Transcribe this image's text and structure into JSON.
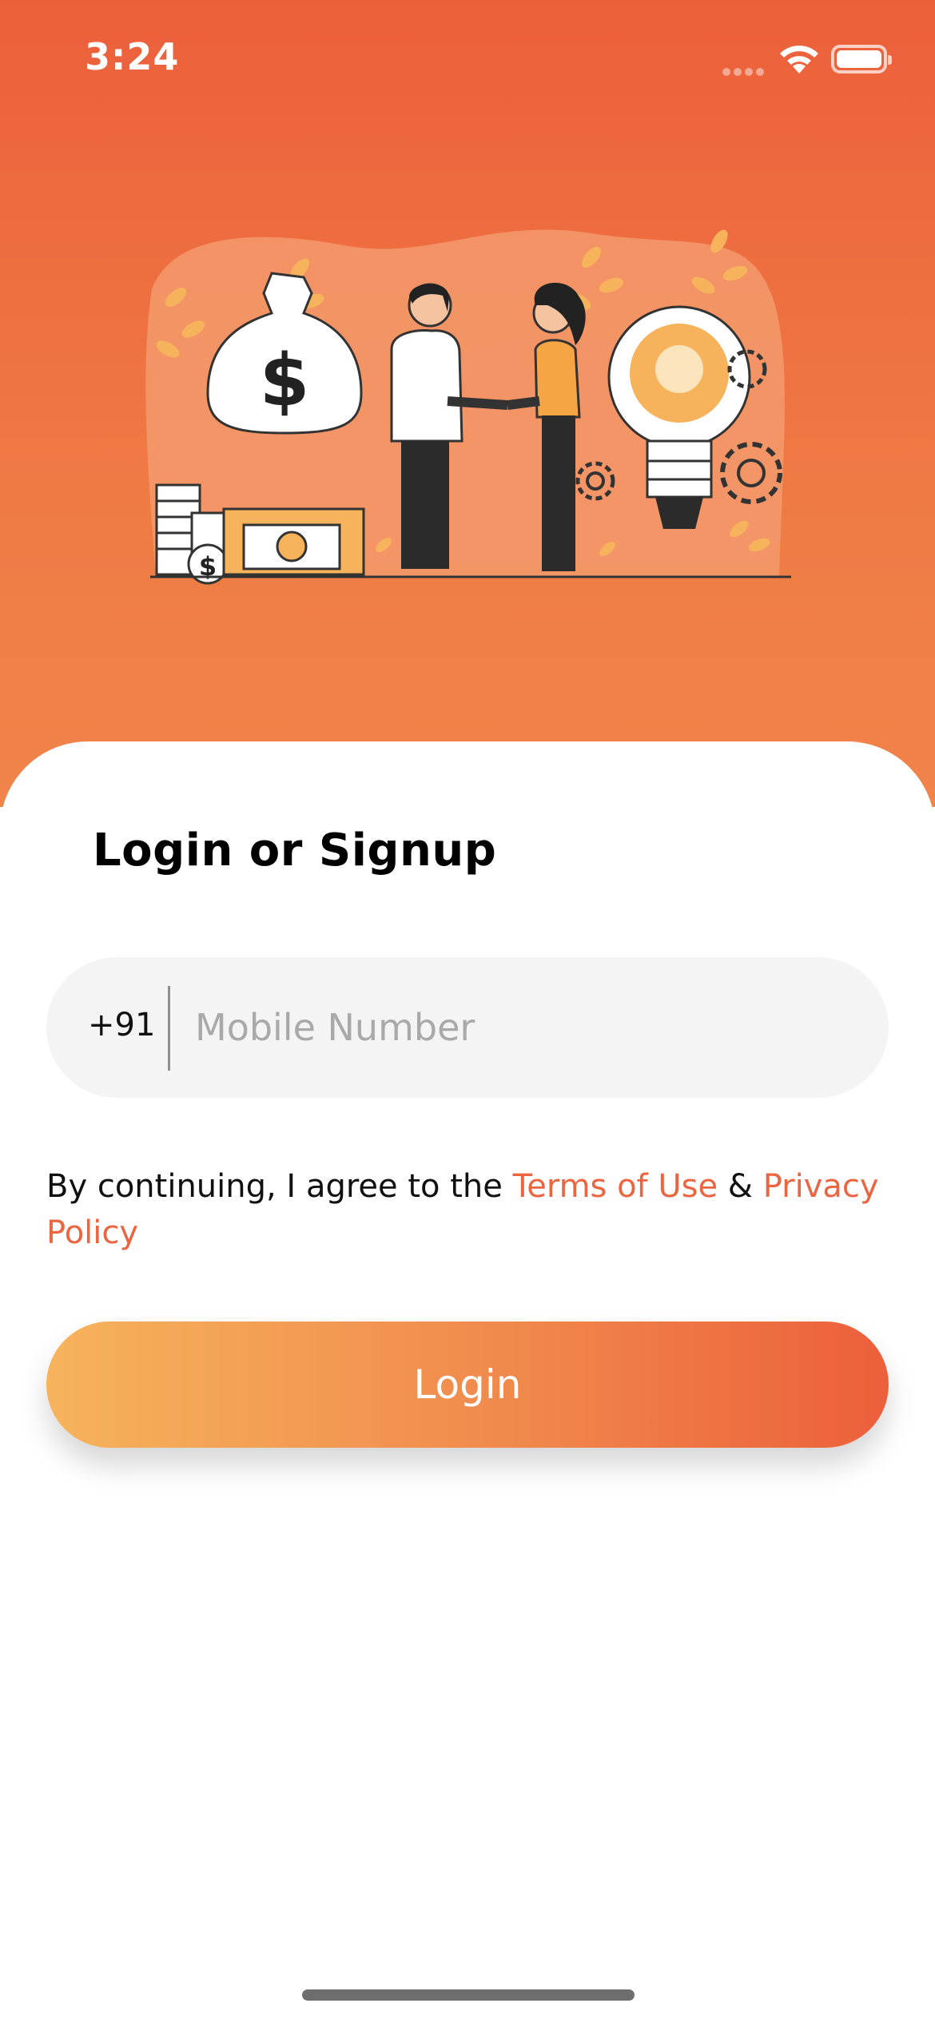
{
  "status_bar": {
    "time": "3:24"
  },
  "illustration": {
    "description_icon": "handshake-illustration-icon",
    "money_symbol": "$",
    "coin_symbol": "$"
  },
  "login": {
    "title": "Login or Signup",
    "country_code": "+91",
    "phone_placeholder": "Mobile Number",
    "phone_value": "",
    "terms_prefix": "By continuing, I agree to the ",
    "terms_link": "Terms of Use",
    "terms_and": " & ",
    "privacy_link": "Privacy Policy",
    "button_label": "Login"
  },
  "colors": {
    "brand_orange": "#ec5f3b",
    "gradient_start": "#f6b35c",
    "gradient_end": "#ec5f3b",
    "link": "#ec6541"
  }
}
